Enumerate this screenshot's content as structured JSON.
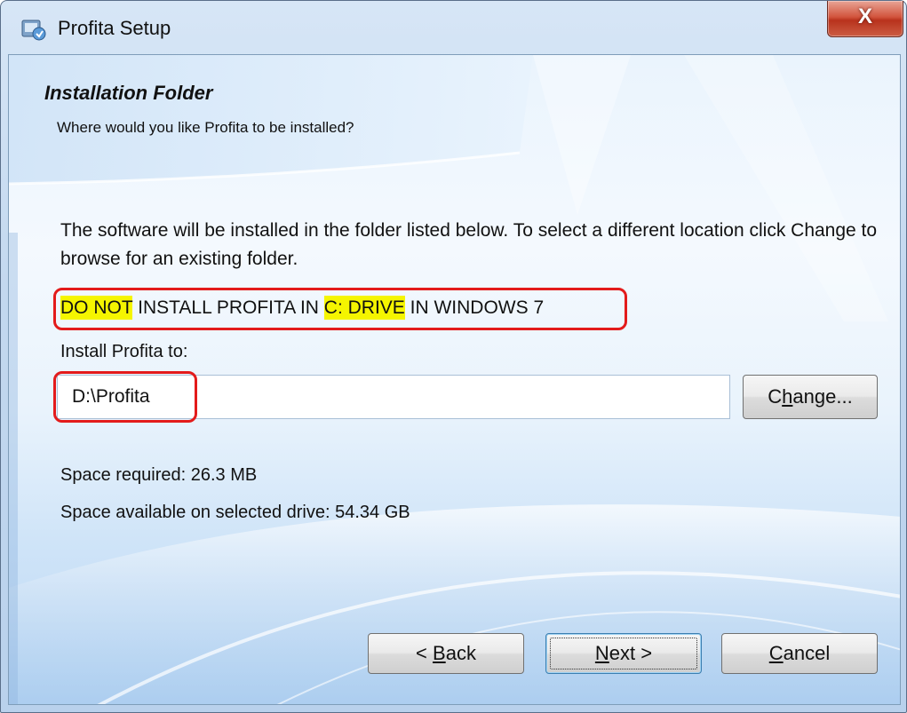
{
  "window": {
    "title": "Profita Setup",
    "close_glyph": "X",
    "icon": "installer-icon"
  },
  "header": {
    "title": "Installation Folder",
    "subtitle": "Where would you like Profita to be installed?"
  },
  "body": {
    "intro": "The software will be installed in the folder listed below. To select a different location click Change to browse for an existing folder.",
    "warning": {
      "part1": "DO NOT",
      "part2": " INSTALL PROFITA IN ",
      "part3": "C: DRIVE",
      "part4": " IN WINDOWS 7"
    },
    "install_label": "Install Profita to:",
    "install_path": "D:\\Profita",
    "change_button": {
      "pre": "C",
      "hot": "h",
      "post": "ange..."
    },
    "space_required": "Space required: 26.3 MB",
    "space_available": "Space available on selected drive: 54.34 GB"
  },
  "footer": {
    "back": {
      "pre": "< ",
      "hot": "B",
      "post": "ack"
    },
    "next": {
      "hot": "N",
      "post": "ext >"
    },
    "cancel": {
      "hot": "C",
      "post": "ancel"
    }
  },
  "colors": {
    "highlight": "#f5f500",
    "annotation_red": "#e31b1b",
    "accent": "#3c7fb1"
  }
}
